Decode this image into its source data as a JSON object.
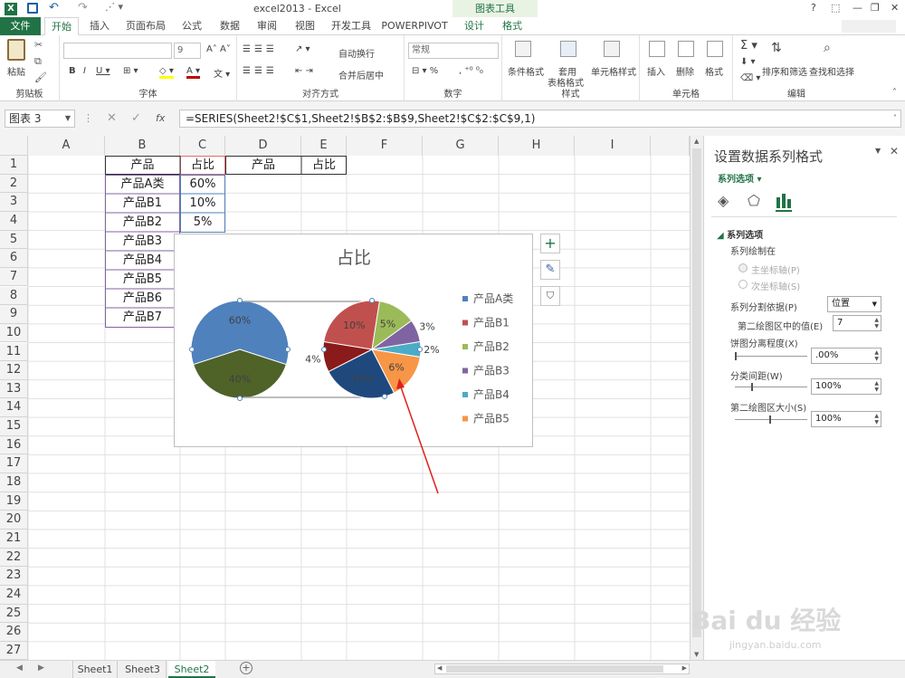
{
  "window": {
    "title": "excel2013 - Excel",
    "chart_tools_label": "图表工具",
    "controls": [
      "?",
      "⬚",
      "—",
      "❐",
      "✕"
    ]
  },
  "tabs": {
    "file": "文件",
    "items": [
      "开始",
      "插入",
      "页面布局",
      "公式",
      "数据",
      "审阅",
      "视图",
      "开发工具",
      "POWERPIVOT",
      "设计",
      "格式"
    ],
    "active": "开始"
  },
  "ribbon": {
    "clipboard": {
      "paste": "粘贴",
      "label": "剪贴板"
    },
    "font": {
      "size": "9",
      "label": "字体"
    },
    "alignment": {
      "wrap": "自动换行",
      "merge": "合并后居中",
      "label": "对齐方式"
    },
    "number": {
      "format": "常规",
      "label": "数字"
    },
    "styles": {
      "conditional": "条件格式",
      "table": "套用",
      "table2": "表格格式",
      "cell_styles": "单元格样式",
      "label": "样式"
    },
    "cells": {
      "insert": "插入",
      "delete": "删除",
      "format": "格式",
      "label": "单元格"
    },
    "editing": {
      "sort": "排序和筛选",
      "find": "查找和选择",
      "label": "编辑"
    }
  },
  "formula_bar": {
    "name_box": "图表 3",
    "fx": "fx",
    "formula": "=SERIES(Sheet2!$C$1,Sheet2!$B$2:$B$9,Sheet2!$C$2:$C$9,1)"
  },
  "columns": [
    "A",
    "B",
    "C",
    "D",
    "E",
    "F",
    "G",
    "H",
    "I"
  ],
  "rows": [
    "1",
    "2",
    "3",
    "4",
    "5",
    "6",
    "7",
    "8",
    "9",
    "10",
    "11",
    "12",
    "13",
    "14",
    "15",
    "16",
    "17",
    "18",
    "19",
    "20",
    "21",
    "22",
    "23",
    "24",
    "25",
    "26",
    "27"
  ],
  "cells": {
    "B1": "产品",
    "C1": "占比",
    "D1": "产品",
    "E1": "占比",
    "B2": "产品A类",
    "C2": "60%",
    "B3": "产品B1",
    "C3": "10%",
    "B4": "产品B2",
    "C4": "5%",
    "B5": "产品B3",
    "B6": "产品B4",
    "B7": "产品B5",
    "B8": "产品B6",
    "B9": "产品B7"
  },
  "chart_data": {
    "type": "pie",
    "title": "占比",
    "main_pie": [
      {
        "label": "60%",
        "value": 60,
        "color": "#4f81bd"
      },
      {
        "label": "40%",
        "value": 40,
        "color": "#4f6228"
      }
    ],
    "second_pie": [
      {
        "name": "产品B1",
        "label": "10%",
        "value": 10,
        "color": "#c0504d"
      },
      {
        "name": "产品B2",
        "label": "5%",
        "value": 5,
        "color": "#9bbb59"
      },
      {
        "name": "产品B3",
        "label": "3%",
        "value": 3,
        "color": "#8064a2"
      },
      {
        "name": "产品B4",
        "label": "2%",
        "value": 2,
        "color": "#4bacc6"
      },
      {
        "name": "产品B5",
        "label": "6%",
        "value": 6,
        "color": "#f79646"
      },
      {
        "name": "产品B6",
        "label": "10%",
        "value": 10,
        "color": "#1f497d"
      },
      {
        "name": "产品B7",
        "label": "4%",
        "value": 4,
        "color": "#8b1a1a"
      }
    ],
    "legend": [
      {
        "name": "产品A类",
        "color": "#4f81bd"
      },
      {
        "name": "产品B1",
        "color": "#c0504d"
      },
      {
        "name": "产品B2",
        "color": "#9bbb59"
      },
      {
        "name": "产品B3",
        "color": "#8064a2"
      },
      {
        "name": "产品B4",
        "color": "#4bacc6"
      },
      {
        "name": "产品B5",
        "color": "#f79646"
      }
    ],
    "legend_position": "right"
  },
  "pane": {
    "title": "设置数据系列格式",
    "series_options": "系列选项",
    "section": "系列选项",
    "plot_on": "系列绘制在",
    "primary_axis": "主坐标轴(P)",
    "secondary_axis": "次坐标轴(S)",
    "split_by": "系列分割依据(P)",
    "split_by_value": "位置",
    "second_plot_values": "第二绘图区中的值(E)",
    "second_plot_values_value": "7",
    "explosion": "饼图分离程度(X)",
    "explosion_value": ".00%",
    "gap_width": "分类间距(W)",
    "gap_width_value": "100%",
    "second_plot_size": "第二绘图区大小(S)",
    "second_plot_size_value": "100%"
  },
  "sheets": {
    "tabs": [
      "Sheet1",
      "Sheet3",
      "Sheet2"
    ],
    "active": "Sheet2"
  },
  "watermark": {
    "brand": "Bai du 经验",
    "url": "jingyan.baidu.com"
  }
}
